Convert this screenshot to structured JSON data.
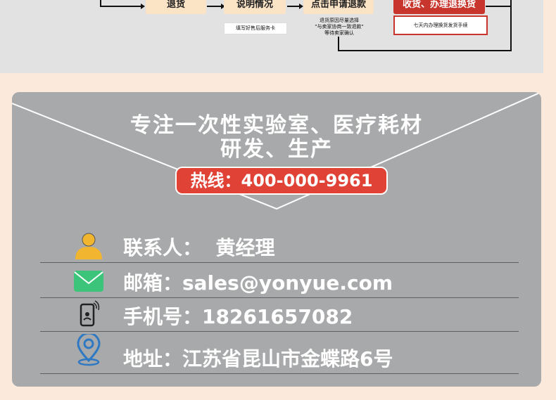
{
  "flow": {
    "steps": [
      "退货",
      "说明情况",
      "点击申请退款",
      "收货、办理退换货"
    ],
    "notes": [
      "填写好售后服务卡",
      "退货原因尽量选择\n\"与卖家协商一致退款\"\n等待卖家确认",
      "七天内办理换货发货手续"
    ]
  },
  "card": {
    "headline_1": "专注一次性实验室、医疗耗材",
    "headline_2": "研发、生产",
    "hotline": "热线：400-000-9961"
  },
  "contact": {
    "person": "联系人：  黄经理",
    "email": "邮箱：sales@yonyue.com",
    "phone": "手机号：18261657082",
    "address": "地址：江苏省昆山市金蝶路6号"
  },
  "icons": {
    "person": "person-icon",
    "email": "envelope-icon",
    "phone": "mobile-phone-icon",
    "address": "location-pin-icon"
  },
  "colors": {
    "accent_red": "#e04336",
    "card_gray": "#a7a9aa",
    "page_bg": "#fbe9dc",
    "envelope_green": "#3cc47a",
    "person_yellow": "#f2b530",
    "pin_blue": "#2f79c4"
  }
}
